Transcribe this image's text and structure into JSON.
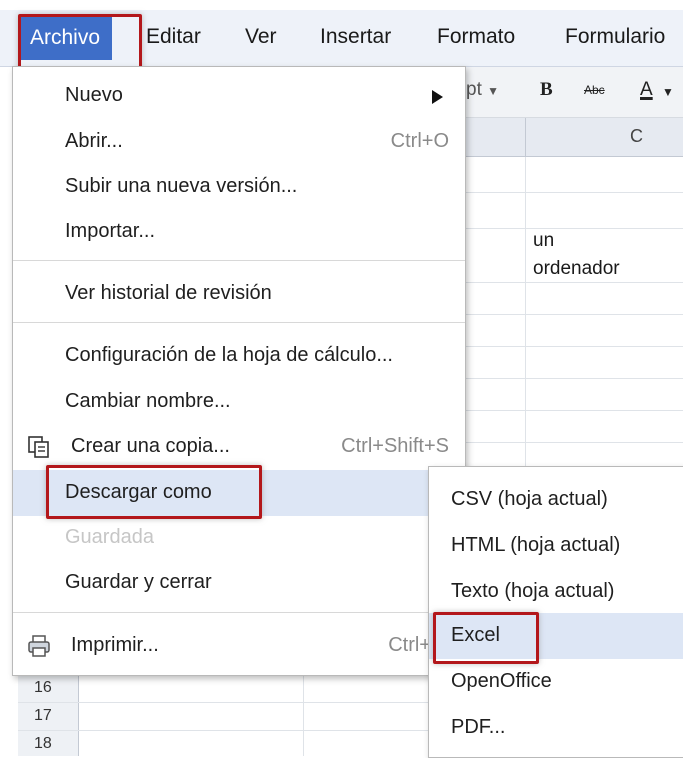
{
  "menubar": {
    "items": [
      "Archivo",
      "Editar",
      "Ver",
      "Insertar",
      "Formato",
      "Formulario"
    ]
  },
  "toolbar": {
    "font_size": "pt",
    "bold": "B",
    "strike": "Abc",
    "text_color": "A"
  },
  "sheet": {
    "column_c": "C",
    "cells": [
      "un",
      "ordenador"
    ],
    "rows": [
      "16",
      "17",
      "18"
    ]
  },
  "file_menu": {
    "items": [
      {
        "label": "Nuevo",
        "shortcut": ""
      },
      {
        "label": "Abrir...",
        "shortcut": "Ctrl+O"
      },
      {
        "label": "Subir una nueva versión...",
        "shortcut": ""
      },
      {
        "label": "Importar...",
        "shortcut": ""
      },
      {
        "label": "Ver historial de revisión",
        "shortcut": ""
      },
      {
        "label": "Configuración de la hoja de cálculo...",
        "shortcut": ""
      },
      {
        "label": "Cambiar nombre...",
        "shortcut": ""
      },
      {
        "label": "Crear una copia...",
        "shortcut": "Ctrl+Shift+S"
      },
      {
        "label": "Descargar como",
        "shortcut": ""
      },
      {
        "label": "Guardada",
        "shortcut": ""
      },
      {
        "label": "Guardar y cerrar",
        "shortcut": ""
      },
      {
        "label": "Imprimir...",
        "shortcut": "Ctrl+"
      }
    ]
  },
  "download_submenu": {
    "items": [
      {
        "label": "CSV (hoja actual)"
      },
      {
        "label": "HTML (hoja actual)"
      },
      {
        "label": "Texto (hoja actual)"
      },
      {
        "label": "Excel"
      },
      {
        "label": "OpenOffice"
      },
      {
        "label": "PDF..."
      }
    ]
  },
  "colors": {
    "menubar_bg": "#eef2f9",
    "active_menu_bg": "#3e6ec8",
    "highlight_box": "#b3171b",
    "hover_bg": "#dde6f5",
    "disabled_text": "#c6c6c6"
  }
}
